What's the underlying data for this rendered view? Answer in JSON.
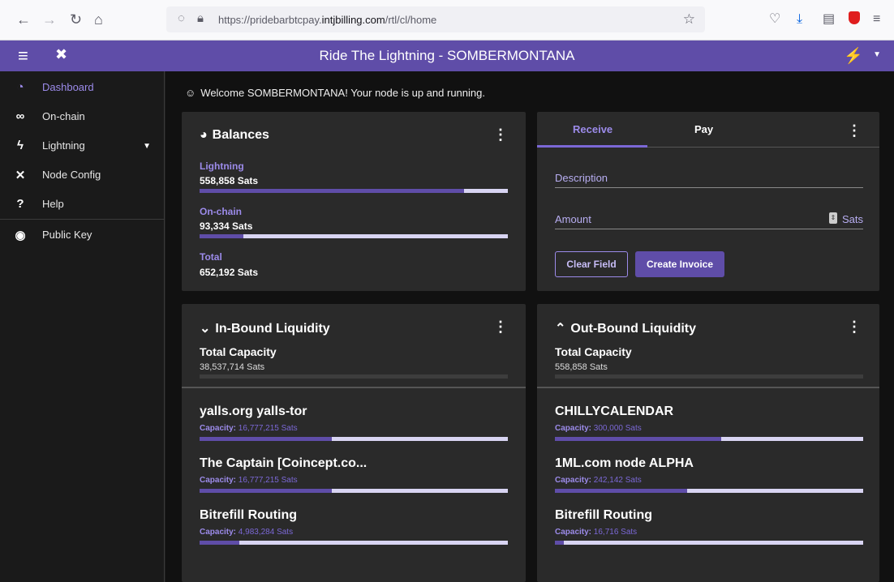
{
  "browser": {
    "url_prefix": "https://pridebarbtcpay.",
    "url_domain": "intjbilling.com",
    "url_path": "/rtl/cl/home"
  },
  "app": {
    "title": "Ride The Lightning - SOMBERMONTANA"
  },
  "sidebar": {
    "items": [
      {
        "label": "Dashboard",
        "icon": "speedometer-icon"
      },
      {
        "label": "On-chain",
        "icon": "link-icon"
      },
      {
        "label": "Lightning",
        "icon": "bolt-icon"
      },
      {
        "label": "Node Config",
        "icon": "tools-icon"
      },
      {
        "label": "Help",
        "icon": "question-icon"
      },
      {
        "label": "Public Key",
        "icon": "eye-icon"
      }
    ]
  },
  "welcome": "Welcome SOMBERMONTANA! Your node is up and running.",
  "balances": {
    "title": "Balances",
    "lightning_label": "Lightning",
    "lightning_value": "558,858 Sats",
    "lightning_fraction": 0.857,
    "onchain_label": "On-chain",
    "onchain_value": "93,334 Sats",
    "onchain_fraction": 0.143,
    "total_label": "Total",
    "total_value": "652,192 Sats"
  },
  "invoice": {
    "tab_receive": "Receive",
    "tab_pay": "Pay",
    "description_placeholder": "Description",
    "amount_placeholder": "Amount",
    "amount_unit": "Sats",
    "clear_label": "Clear Field",
    "create_label": "Create Invoice"
  },
  "inbound": {
    "title": "In-Bound Liquidity",
    "total_label": "Total Capacity",
    "total_value": "38,537,714 Sats",
    "peers": [
      {
        "name": "yalls.org yalls-tor",
        "capacity_label": "Capacity:",
        "capacity": "16,777,215 Sats",
        "fraction": 0.43
      },
      {
        "name": "The Captain [Coincept.co...",
        "capacity_label": "Capacity:",
        "capacity": "16,777,215 Sats",
        "fraction": 0.43
      },
      {
        "name": "Bitrefill Routing",
        "capacity_label": "Capacity:",
        "capacity": "4,983,284 Sats",
        "fraction": 0.13
      }
    ]
  },
  "outbound": {
    "title": "Out-Bound Liquidity",
    "total_label": "Total Capacity",
    "total_value": "558,858 Sats",
    "peers": [
      {
        "name": "CHILLYCALENDAR",
        "capacity_label": "Capacity:",
        "capacity": "300,000 Sats",
        "fraction": 0.54
      },
      {
        "name": "1ML.com node ALPHA",
        "capacity_label": "Capacity:",
        "capacity": "242,142 Sats",
        "fraction": 0.43
      },
      {
        "name": "Bitrefill Routing",
        "capacity_label": "Capacity:",
        "capacity": "16,716 Sats",
        "fraction": 0.03
      }
    ]
  },
  "colors": {
    "accent": "#5f4da8",
    "accent_light": "#9c8bea",
    "bar_track": "#d8d4f2"
  }
}
